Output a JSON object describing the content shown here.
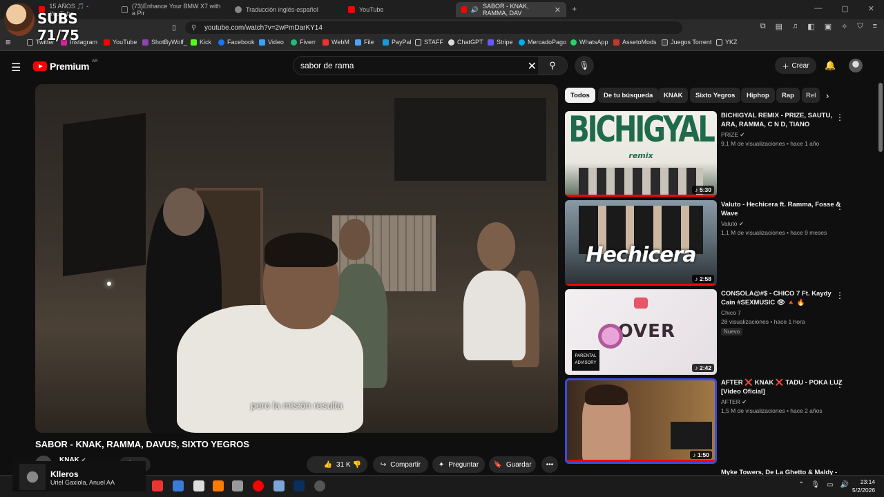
{
  "browser": {
    "tabs": [
      {
        "label": "15 AÑOS 🎵 - YouTube"
      },
      {
        "label": "(73)Enhance Your BMW X7 with a Pir"
      },
      {
        "label": "Traducción inglés-español"
      },
      {
        "label": "YouTube"
      },
      {
        "label": "SABOR - KNAK, RAMMA, DAV"
      }
    ],
    "new_tab": "+",
    "url": "youtube.com/watch?v=2wPmDarKY14",
    "bookmarks": [
      "Twitter",
      "Instagram",
      "YouTube",
      "ShotByWolf_",
      "Kick",
      "Facebook",
      "Video",
      "Fiverr",
      "WebM",
      "File",
      "PayPal",
      "STAFF",
      "ChatGPT",
      "Stripe",
      "MercadoPago",
      "WhatsApp",
      "AssetoMods",
      "Juegos Torrent",
      "YKZ"
    ]
  },
  "overlay": {
    "subs_text": "SUBS 71/75"
  },
  "header": {
    "logo_word": "Premium",
    "logo_region": "AR",
    "search_value": "sabor de rama",
    "create_label": "Crear"
  },
  "player": {
    "subtitle": "pero la misión resulta"
  },
  "video": {
    "title": "SABOR - KNAK, RAMMA, DAVUS, SIXTO YEGROS",
    "channel": "KNAK",
    "likes": "31 K",
    "share_label": "Compartir",
    "ask_label": "Preguntar",
    "save_label": "Guardar"
  },
  "chips": [
    "Todos",
    "De tu búsqueda",
    "KNAK",
    "Sixto Yegros",
    "Hiphop",
    "Rap",
    "Rel"
  ],
  "recommendations": [
    {
      "title": "BICHIGYAL REMIX - PRIZE, SAUTU, ARA, RAMMA, C N D, TIANO",
      "channel": "PRIZE",
      "meta": "9,1 M de visualizaciones • hace 1 año",
      "duration": "5:30",
      "thumb_text": "BICHIGYAL",
      "thumb_sub": "remix"
    },
    {
      "title": "Valuto - Hechicera ft. Ramma, Fosse & Wave",
      "channel": "Valuto",
      "meta": "1,1 M de visualizaciones • hace 9 meses",
      "duration": "2:58",
      "thumb_text": "Hechicera"
    },
    {
      "title": "CONSOLA@#$ - CHICO 7 Ft. Kaydy Cain #SEXMUSIC 👁 🔺 🔥",
      "channel": "Chico 7",
      "meta": "28 visualizaciones • hace 1 hora",
      "badge": "Nuevo",
      "duration": "2:42",
      "thumb_text": "LOVER"
    },
    {
      "title": "AFTER ❌ KNAK ❌ TADU - POKA LUZ [Video Oficial]",
      "channel": "AFTER",
      "meta": "1,5 M de visualizaciones • hace 2 años",
      "duration": "1:50"
    },
    {
      "title": "Myke Towers, De La Ghetto & Maldy -"
    }
  ],
  "music": {
    "title": "Klleros",
    "artist": "Uriel Gaxiola, Anuel AA"
  },
  "taskbar": {
    "time": "23:14",
    "date": "5/2/2026"
  },
  "colors": {
    "accent": "#ff0000",
    "bg": "#0f0f0f",
    "chip": "#272727"
  }
}
